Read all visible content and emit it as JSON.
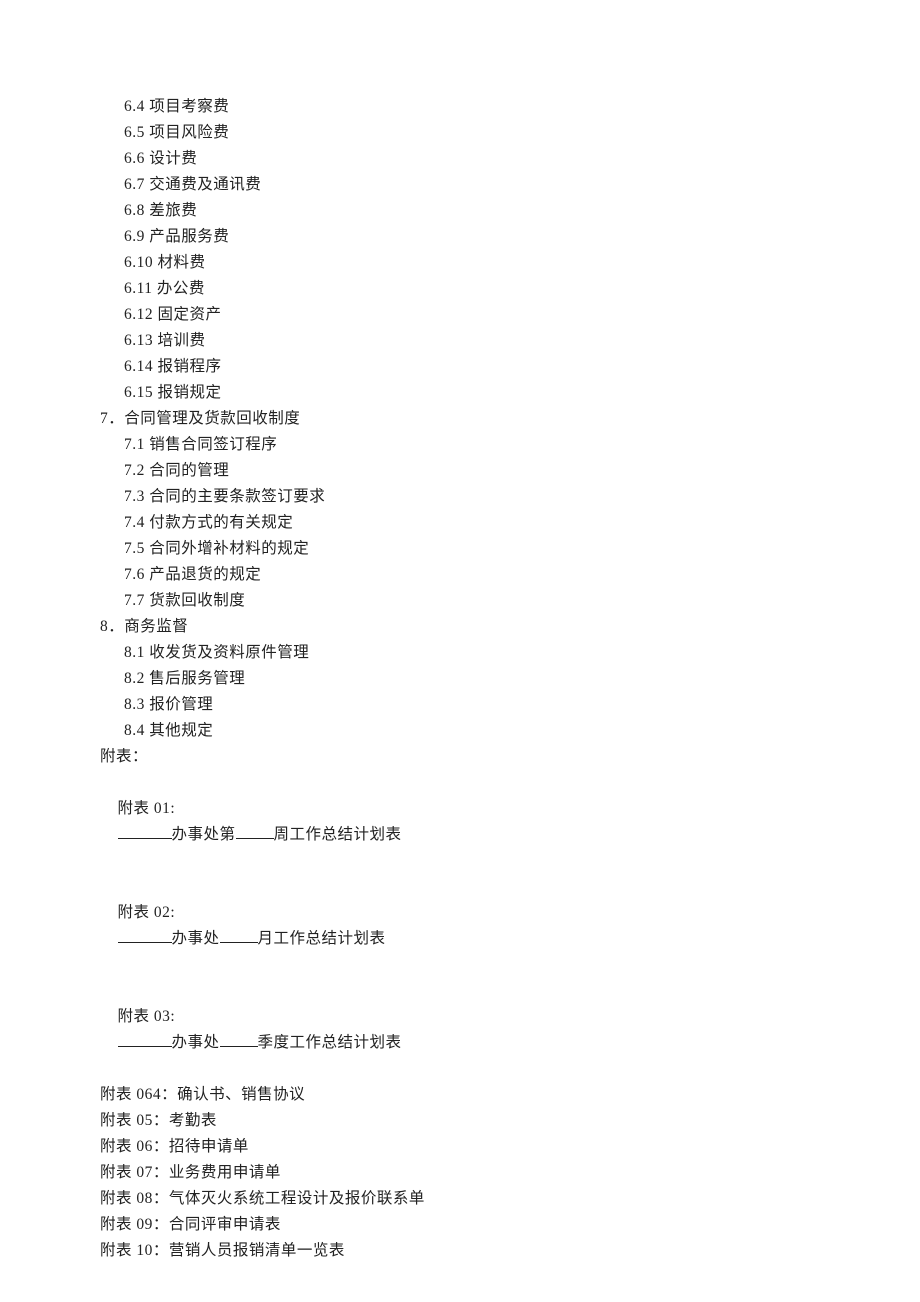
{
  "sec6": {
    "i4": "6.4 项目考察费",
    "i5": "6.5 项目风险费",
    "i6": "6.6 设计费",
    "i7": "6.7 交通费及通讯费",
    "i8": "6.8 差旅费",
    "i9": "6.9 产品服务费",
    "i10": "6.10 材料费",
    "i11": "6.11 办公费",
    "i12": "6.12 固定资产",
    "i13": "6.13 培训费",
    "i14": "6.14 报销程序",
    "i15": "6.15 报销规定"
  },
  "sec7": {
    "title": "7．合同管理及货款回收制度",
    "i1": "7.1 销售合同签订程序",
    "i2": "7.2 合同的管理",
    "i3": "7.3 合同的主要条款签订要求",
    "i4": "7.4 付款方式的有关规定",
    "i5": "7.5 合同外增补材料的规定",
    "i6": "7.6 产品退货的规定",
    "i7": "7.7 货款回收制度"
  },
  "sec8": {
    "title": "8．商务监督",
    "i1": "8.1 收发货及资料原件管理",
    "i2": "8.2 售后服务管理",
    "i3": "8.3 报价管理",
    "i4": "8.4 其他规定"
  },
  "appendix": {
    "title": "附表：",
    "a01": {
      "pre": "附表 01:",
      "mid": "办事处第",
      "tail": "周工作总结计划表"
    },
    "a02": {
      "pre": "附表 02:",
      "mid": "办事处",
      "tail": "月工作总结计划表"
    },
    "a03": {
      "pre": "附表 03:",
      "mid": "办事处",
      "tail": "季度工作总结计划表"
    },
    "a04": "附表 064：确认书、销售协议",
    "a05": "附表 05：考勤表",
    "a06": "附表 06：招待申请单",
    "a07": "附表 07：业务费用申请单",
    "a08": "附表 08：气体灭火系统工程设计及报价联系单",
    "a09": "附表 09：合同评审申请表",
    "a10": "附表 10：营销人员报销清单一览表"
  }
}
